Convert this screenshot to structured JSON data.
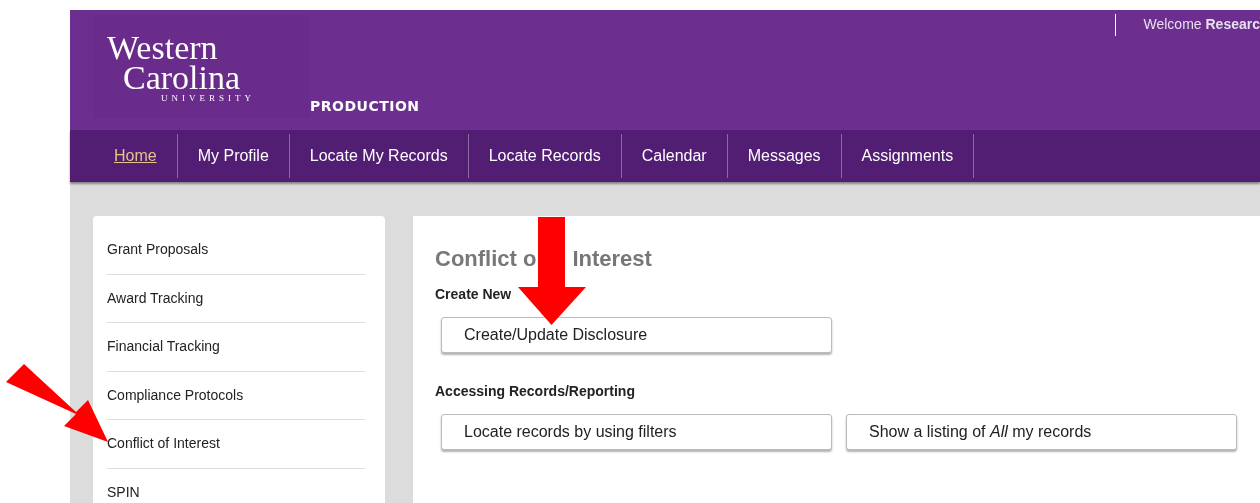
{
  "header": {
    "logo": {
      "line_1": "Western",
      "line_2": "Carolina",
      "line_3": "UNIVERSITY"
    },
    "environment": "PRODUCTION",
    "welcome": "Welcome **Researc**"
  },
  "nav": [
    {
      "label": "Home",
      "selected": true
    },
    {
      "label": "My Profile",
      "selected": false
    },
    {
      "label": "Locate My Records",
      "selected": false
    },
    {
      "label": "Locate Records",
      "selected": false
    },
    {
      "label": "Calendar",
      "selected": false
    },
    {
      "label": "Messages",
      "selected": false
    },
    {
      "label": "Assignments",
      "selected": false
    }
  ],
  "sidebar": {
    "items": [
      "Grant Proposals",
      "Award Tracking",
      "Financial Tracking",
      "Compliance Protocols",
      "Conflict of Interest",
      "SPIN"
    ]
  },
  "main": {
    "title_parts": [
      "Conflict o",
      "Interest"
    ],
    "sections": [
      {
        "heading": "Create New",
        "buttons": [
          "Create/Update Disclosure"
        ]
      },
      {
        "heading": "Accessing Records/Reporting",
        "buttons": [
          "Locate records by using filters",
          "Show a listing of *All* my records"
        ]
      }
    ]
  }
}
